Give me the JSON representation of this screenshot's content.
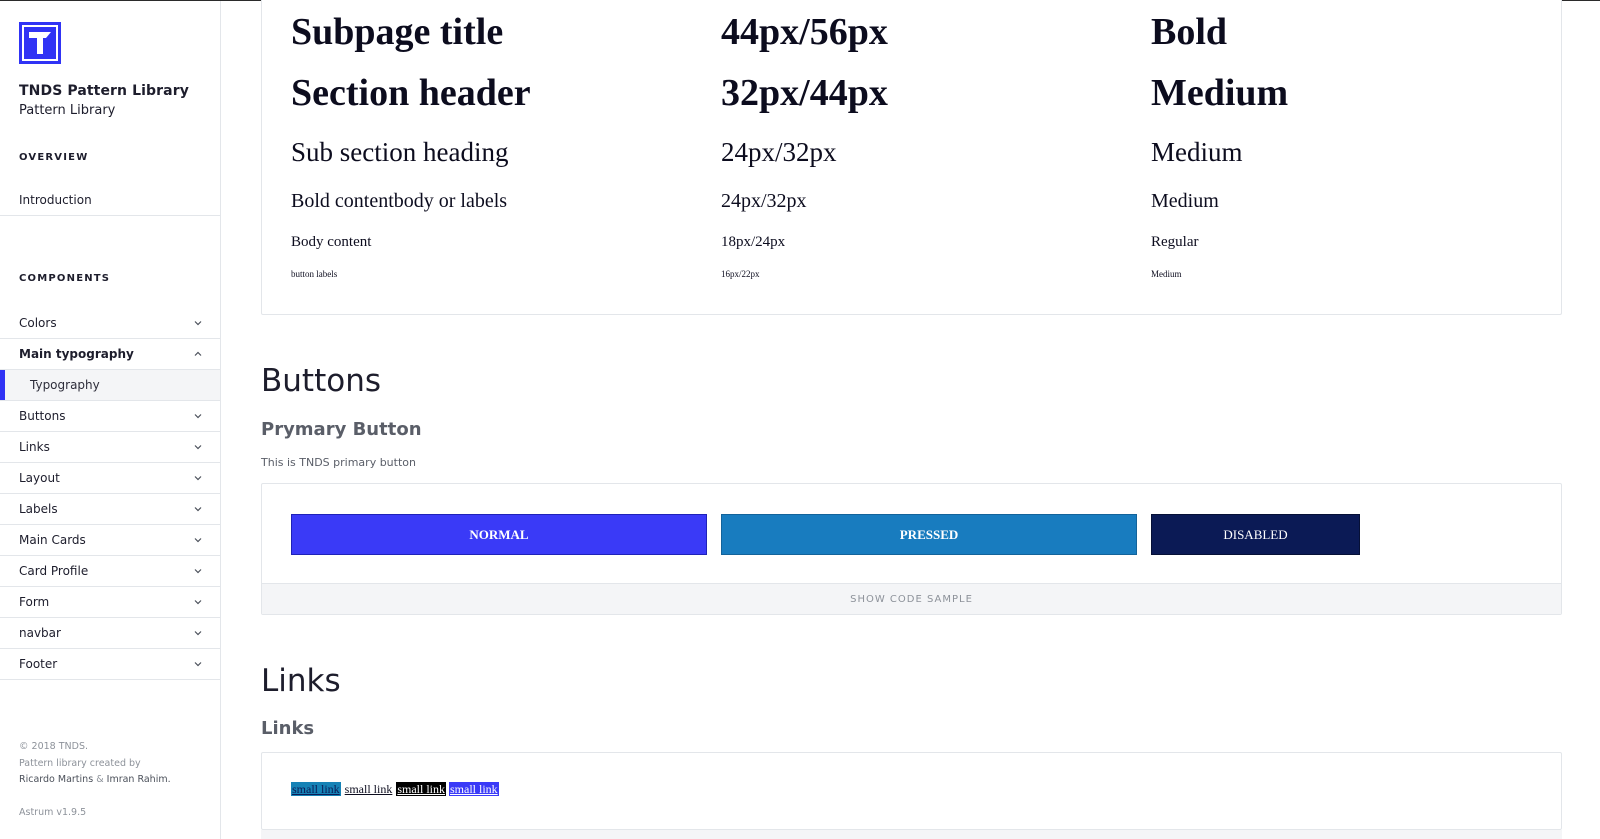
{
  "sidebar": {
    "brand_title": "TNDS Pattern Library",
    "brand_subtitle": "Pattern Library",
    "overview_label": "OVERVIEW",
    "intro_label": "Introduction",
    "components_label": "COMPONENTS",
    "items": [
      {
        "label": "Colors",
        "icon": "chevron-down-icon"
      },
      {
        "label": "Main typography",
        "icon": "chevron-up-icon",
        "expanded": true
      },
      {
        "label": "Typography",
        "sub": true,
        "selected": true
      },
      {
        "label": "Buttons",
        "icon": "chevron-down-icon"
      },
      {
        "label": "Links",
        "icon": "chevron-down-icon"
      },
      {
        "label": "Layout",
        "icon": "chevron-down-icon"
      },
      {
        "label": "Labels",
        "icon": "chevron-down-icon"
      },
      {
        "label": "Main Cards",
        "icon": "chevron-down-icon"
      },
      {
        "label": "Card Profile",
        "icon": "chevron-down-icon"
      },
      {
        "label": "Form",
        "icon": "chevron-down-icon"
      },
      {
        "label": "navbar",
        "icon": "chevron-down-icon"
      },
      {
        "label": "Footer",
        "icon": "chevron-down-icon"
      }
    ],
    "footer": {
      "copyright": "© 2018 TNDS.",
      "created_by": "Pattern library created by",
      "author_1": "Ricardo Martins",
      "amp": "&",
      "author_2": "Imran Rahim.",
      "version": "Astrum v1.9.5"
    }
  },
  "typography": {
    "rows": [
      {
        "name": "Subpage title",
        "size": "44px/56px",
        "weight": "Bold"
      },
      {
        "name": "Section header",
        "size": "32px/44px",
        "weight": "Medium"
      },
      {
        "name": "Sub section heading",
        "size": "24px/32px",
        "weight": "Medium"
      },
      {
        "name": "Bold contentbody or labels",
        "size": "24px/32px",
        "weight": "Medium"
      },
      {
        "name": "Body content",
        "size": "18px/24px",
        "weight": "Regular"
      },
      {
        "name": "button labels",
        "size": "16px/22px",
        "weight": "Medium"
      }
    ]
  },
  "buttons_section": {
    "title": "Buttons",
    "subtitle": "Prymary Button",
    "description": "This is TNDS primary button",
    "normal_label": "NORMAL",
    "pressed_label": "PRESSED",
    "disabled_label": "DISABLED",
    "show_code_label": "SHOW CODE SAMPLE"
  },
  "links_section": {
    "title": "Links",
    "subtitle": "Links",
    "links": [
      "small link",
      "small link",
      "small link",
      "small link"
    ]
  },
  "colors": {
    "brand": "#3033f5",
    "button_normal": "#3a3af7",
    "button_pressed": "#187cbf",
    "button_disabled": "#0b1a55",
    "active_indicator": "#3033f5"
  }
}
